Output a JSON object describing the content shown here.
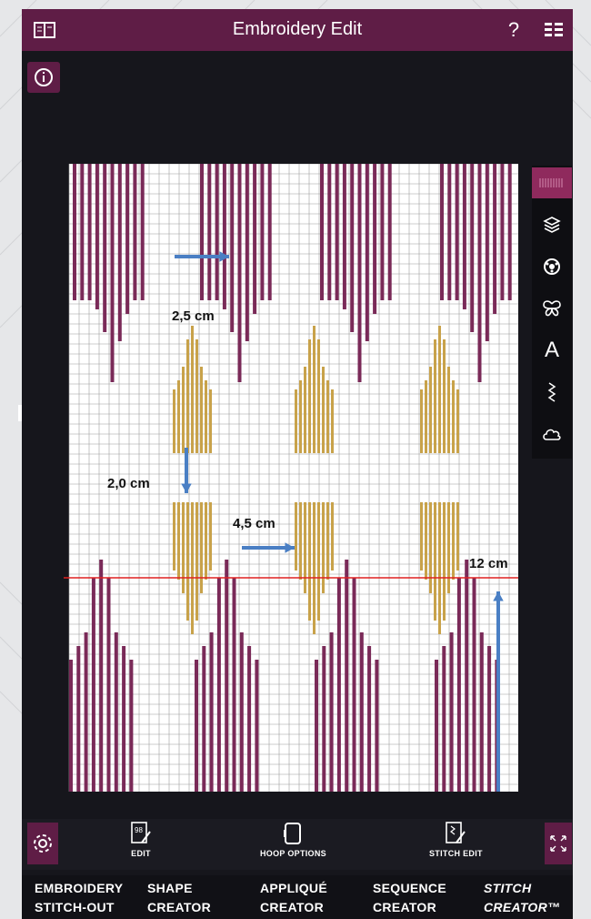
{
  "app": {
    "title": "Embroidery Edit",
    "help_label": "?",
    "colors": {
      "brand": "#5f1d46",
      "active": "#8f2a5d",
      "stripe": "#7a2a58",
      "gold": "#c8a24a",
      "arrow": "#4a7fc4",
      "line": "#e02020"
    }
  },
  "icons": {
    "book": "book-icon",
    "help": "help-icon",
    "menu": "list-menu-icon",
    "info": "info-icon",
    "settings": "gear-icon"
  },
  "annotations": {
    "a1": "2,5 cm",
    "a2": "2,0 cm",
    "a3": "4,5 cm",
    "a4": "12 cm"
  },
  "right_tools": [
    {
      "name": "stitch-tool-icon",
      "active": true
    },
    {
      "name": "layers-icon",
      "active": false
    },
    {
      "name": "color-wheel-icon",
      "active": false
    },
    {
      "name": "butterfly-icon",
      "active": false
    },
    {
      "name": "text-icon",
      "label": "A",
      "active": false
    },
    {
      "name": "zigzag-icon",
      "active": false
    },
    {
      "name": "cloud-icon",
      "active": false
    }
  ],
  "toolbar": {
    "edit": "EDIT",
    "hoop_options": "HOOP OPTIONS",
    "stitch_edit": "STITCH EDIT"
  },
  "nav": {
    "embroidery_1": "Embroidery",
    "embroidery_2": "Stitch-out",
    "shape_1": "Shape",
    "shape_2": "Creator",
    "applique_1": "Appliqué",
    "applique_2": "Creator",
    "sequence_1": "Sequence",
    "sequence_2": "Creator",
    "stitch_1": "Stitch",
    "stitch_2": "Creator™"
  }
}
